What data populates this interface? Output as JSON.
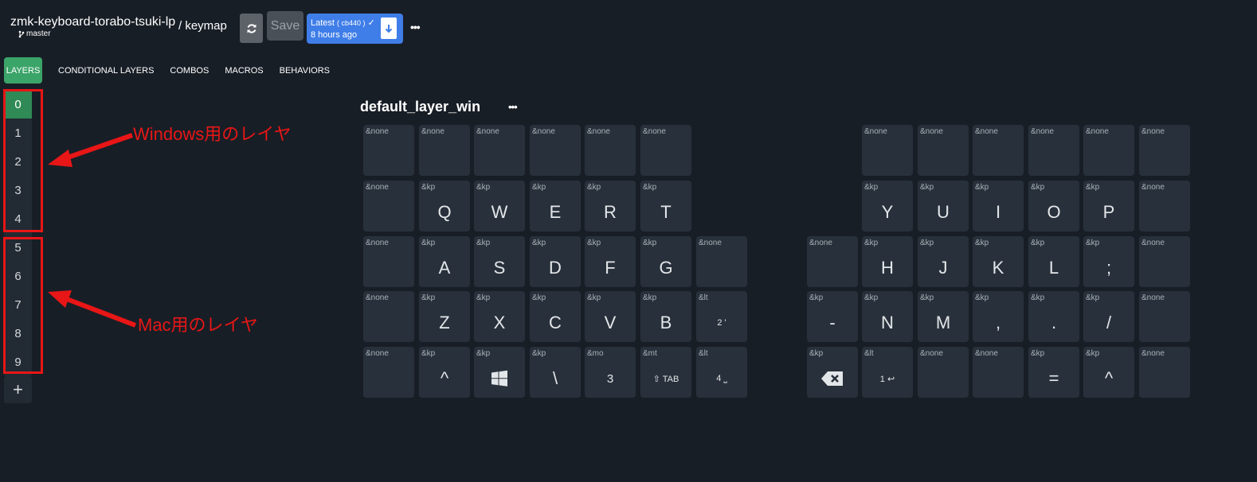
{
  "header": {
    "repo": "zmk-keyboard-torabo-tsuki-lp",
    "branch": "master",
    "file": "/ keymap",
    "save_label": "Save",
    "latest_label": "Latest",
    "latest_hash": "( cb440 )",
    "latest_time": "8 hours ago",
    "more_label": "•••"
  },
  "tabs": [
    "LAYERS",
    "CONDITIONAL LAYERS",
    "COMBOS",
    "MACROS",
    "BEHAVIORS"
  ],
  "layers": [
    "0",
    "1",
    "2",
    "3",
    "4",
    "5",
    "6",
    "7",
    "8",
    "9"
  ],
  "add_layer_label": "+",
  "annotations": {
    "windows": "Windows用のレイヤ",
    "mac": "Mac用のレイヤ"
  },
  "layer_title": "default_layer_win",
  "layer_more": "•••",
  "colors": {
    "accent": "#3ba468",
    "latest": "#3f7ee8",
    "annotation": "#e81616",
    "background": "#181e26",
    "key": "#28313b"
  },
  "keys": [
    {
      "b": "&none",
      "p": ""
    },
    {
      "b": "&none",
      "p": ""
    },
    {
      "b": "&none",
      "p": ""
    },
    {
      "b": "&none",
      "p": ""
    },
    {
      "b": "&none",
      "p": ""
    },
    {
      "b": "&none",
      "p": ""
    },
    {
      "b": "&none",
      "p": ""
    },
    {
      "b": "&none",
      "p": ""
    },
    {
      "b": "&none",
      "p": ""
    },
    {
      "b": "&none",
      "p": ""
    },
    {
      "b": "&none",
      "p": ""
    },
    {
      "b": "&none",
      "p": ""
    },
    {
      "b": "&none",
      "p": ""
    },
    {
      "b": "&kp",
      "p": "Q"
    },
    {
      "b": "&kp",
      "p": "W"
    },
    {
      "b": "&kp",
      "p": "E"
    },
    {
      "b": "&kp",
      "p": "R"
    },
    {
      "b": "&kp",
      "p": "T"
    },
    {
      "b": "&kp",
      "p": "Y"
    },
    {
      "b": "&kp",
      "p": "U"
    },
    {
      "b": "&kp",
      "p": "I"
    },
    {
      "b": "&kp",
      "p": "O"
    },
    {
      "b": "&kp",
      "p": "P"
    },
    {
      "b": "&none",
      "p": ""
    },
    {
      "b": "&none",
      "p": ""
    },
    {
      "b": "&kp",
      "p": "A"
    },
    {
      "b": "&kp",
      "p": "S"
    },
    {
      "b": "&kp",
      "p": "D"
    },
    {
      "b": "&kp",
      "p": "F"
    },
    {
      "b": "&kp",
      "p": "G"
    },
    {
      "b": "&none",
      "p": ""
    },
    {
      "b": "&none",
      "p": ""
    },
    {
      "b": "&kp",
      "p": "H"
    },
    {
      "b": "&kp",
      "p": "J"
    },
    {
      "b": "&kp",
      "p": "K"
    },
    {
      "b": "&kp",
      "p": "L"
    },
    {
      "b": "&kp",
      "p": ";"
    },
    {
      "b": "&none",
      "p": ""
    },
    {
      "b": "&none",
      "p": ""
    },
    {
      "b": "&kp",
      "p": "Z"
    },
    {
      "b": "&kp",
      "p": "X"
    },
    {
      "b": "&kp",
      "p": "C"
    },
    {
      "b": "&kp",
      "p": "V"
    },
    {
      "b": "&kp",
      "p": "B"
    },
    {
      "b": "&lt",
      "p": "2 '",
      "small": true
    },
    {
      "b": "&kp",
      "p": "-"
    },
    {
      "b": "&kp",
      "p": "N"
    },
    {
      "b": "&kp",
      "p": "M"
    },
    {
      "b": "&kp",
      "p": ","
    },
    {
      "b": "&kp",
      "p": "."
    },
    {
      "b": "&kp",
      "p": "/"
    },
    {
      "b": "&none",
      "p": ""
    },
    {
      "b": "&none",
      "p": ""
    },
    {
      "b": "&kp",
      "p": "^"
    },
    {
      "b": "&kp",
      "p": "",
      "icon": "windows-icon"
    },
    {
      "b": "&kp",
      "p": "\\"
    },
    {
      "b": "&mo",
      "p": "3",
      "medium": true
    },
    {
      "b": "&mt",
      "p": "⇧ TAB",
      "small": true
    },
    {
      "b": "&lt",
      "p": "4 ⎵",
      "small": true
    },
    {
      "b": "&kp",
      "p": "",
      "icon": "backspace-icon"
    },
    {
      "b": "&lt",
      "p": "1 ↩",
      "small": true
    },
    {
      "b": "&none",
      "p": ""
    },
    {
      "b": "&none",
      "p": ""
    },
    {
      "b": "&kp",
      "p": "="
    },
    {
      "b": "&kp",
      "p": "^"
    },
    {
      "b": "&none",
      "p": ""
    }
  ]
}
